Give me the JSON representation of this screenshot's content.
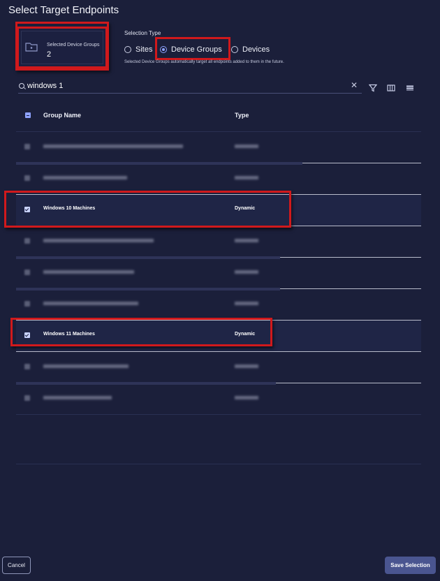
{
  "dialog": {
    "title": "Select Target Endpoints"
  },
  "selected": {
    "label": "Selected Device Groups",
    "count": "2",
    "icon": "folder-icon"
  },
  "selection_type": {
    "label": "Selection Type",
    "options": [
      "Sites",
      "Device Groups",
      "Devices"
    ],
    "selected": "Device Groups",
    "hint": "Selected Device Groups automatically target all endpoints added to them in the future."
  },
  "search": {
    "value": "windows 1",
    "icons": [
      "search-icon",
      "clear-icon",
      "filter-icon",
      "columns-icon",
      "density-icon"
    ]
  },
  "table": {
    "headers": {
      "name": "Group Name",
      "type": "Type"
    },
    "rows": [
      {
        "name": "",
        "type": "",
        "checked": false,
        "obscured": true
      },
      {
        "name": "",
        "type": "",
        "checked": false,
        "obscured": true
      },
      {
        "name": "Windows 10 Machines",
        "type": "Dynamic",
        "checked": true,
        "obscured": false
      },
      {
        "name": "",
        "type": "",
        "checked": false,
        "obscured": true
      },
      {
        "name": "",
        "type": "",
        "checked": false,
        "obscured": true
      },
      {
        "name": "",
        "type": "",
        "checked": false,
        "obscured": true
      },
      {
        "name": "Windows 11 Machines",
        "type": "Dynamic",
        "checked": true,
        "obscured": false
      },
      {
        "name": "",
        "type": "",
        "checked": false,
        "obscured": true
      },
      {
        "name": "",
        "type": "",
        "checked": false,
        "obscured": true
      }
    ]
  },
  "footer": {
    "cancel": "Cancel",
    "save": "Save Selection"
  },
  "colors": {
    "background": "#1b1f3a",
    "accent": "#8ea2ff",
    "highlight": "#d0191c",
    "primary_button": "#4a5590"
  }
}
